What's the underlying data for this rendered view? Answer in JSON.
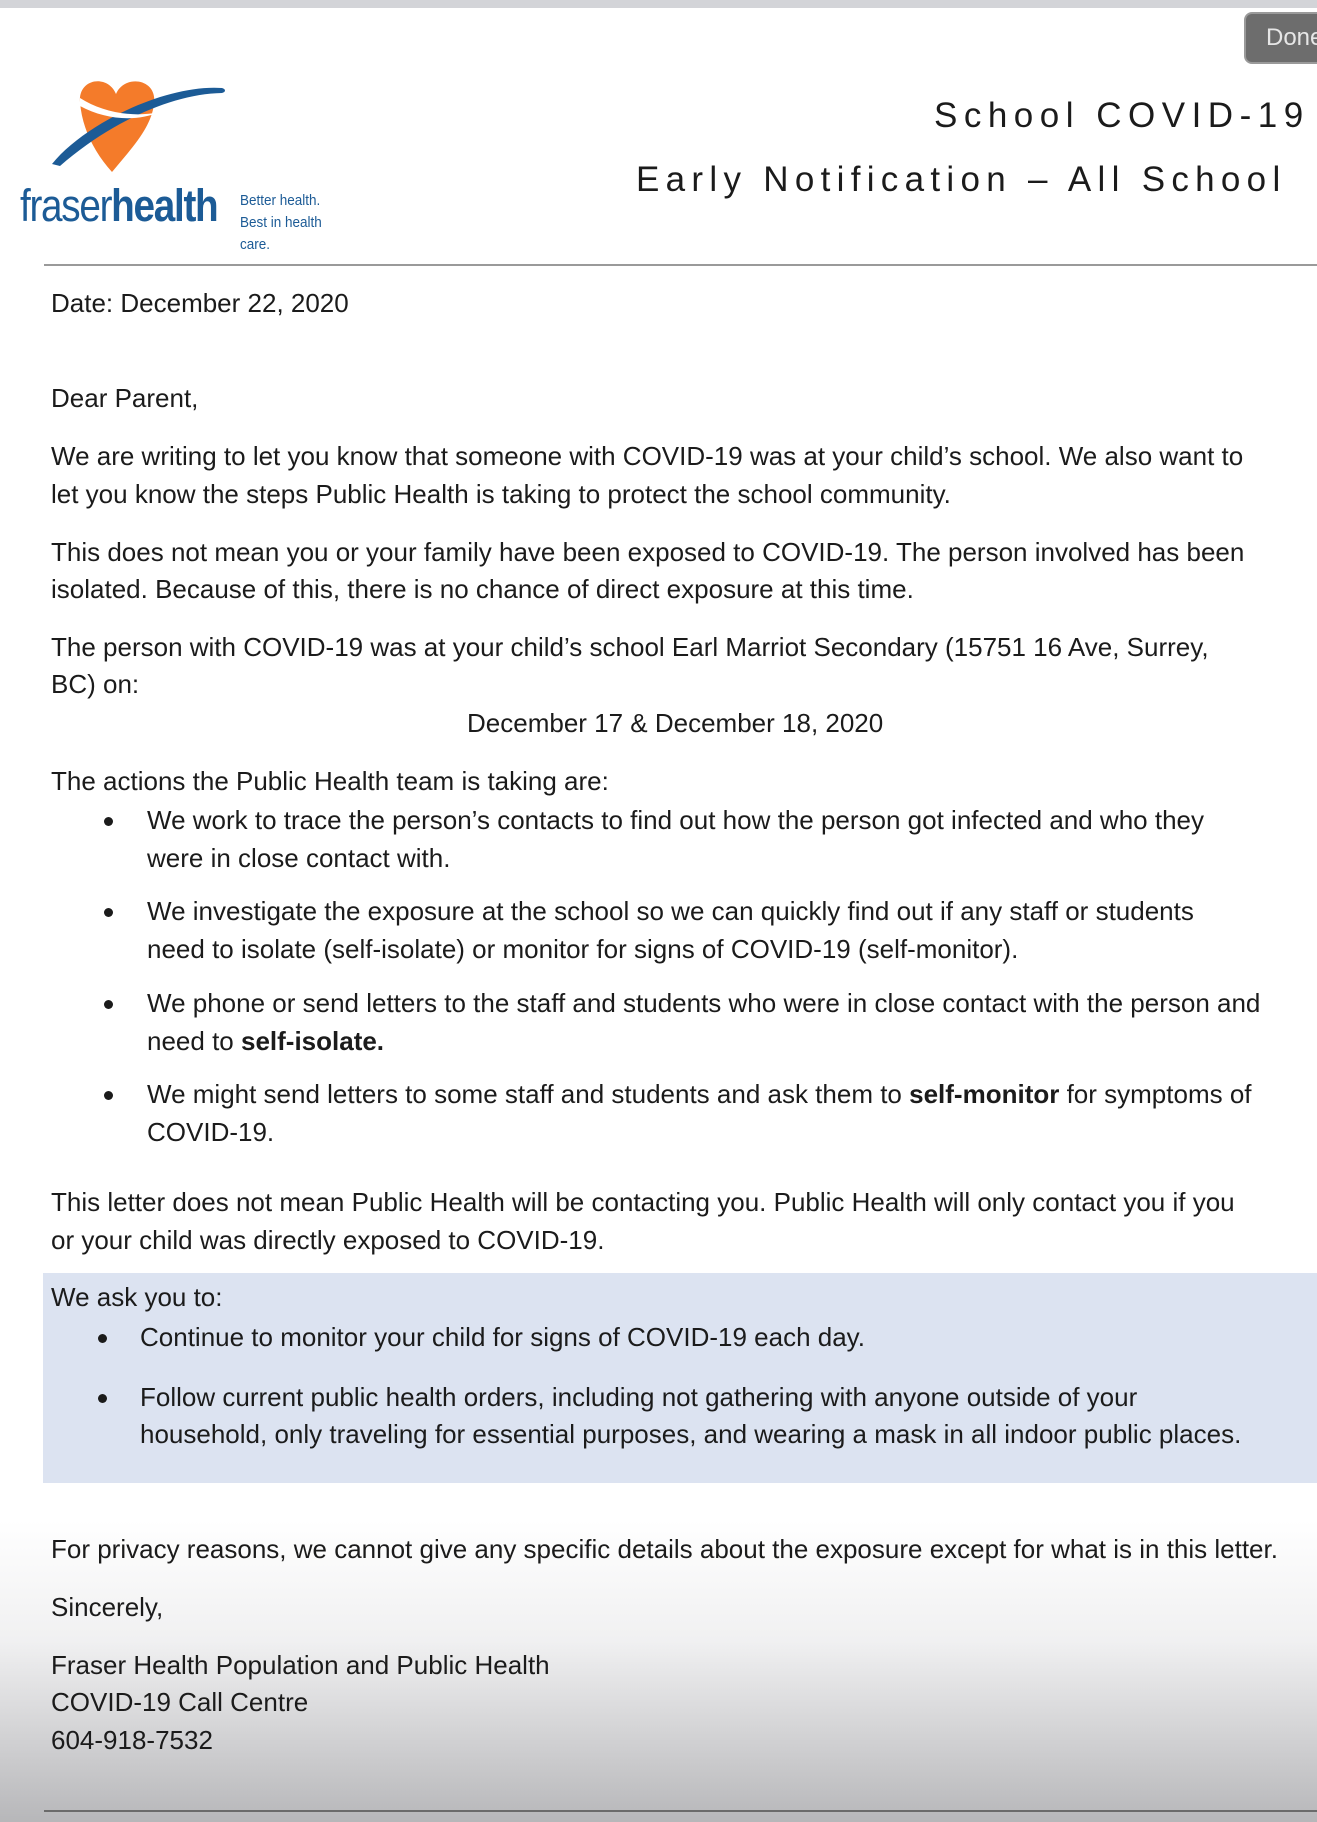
{
  "toolbar": {
    "done_label": "Done"
  },
  "logo": {
    "name_part1": "fraser",
    "name_part2": "health",
    "tagline_line1": "Better health.",
    "tagline_line2": "Best in health care.",
    "colors": {
      "orange": "#f47b2a",
      "blue": "#1c5b96"
    }
  },
  "header": {
    "title_line1": "School COVID-19",
    "title_line2": "Early Notification – All School"
  },
  "letter": {
    "date": "Date: December 22, 2020",
    "greeting": "Dear Parent,",
    "para1_line1": "We are writing to let you know that someone with COVID-19 was at your child’s school. We also want to",
    "para1_line2": "let you know the steps Public Health is taking to protect the school community.",
    "para2_line1": "This does not mean you or your family have been exposed to COVID-19. The person involved has been",
    "para2_line2": "isolated. Because of this, there is no chance of direct exposure at this time.",
    "para3_line1": "The person with COVID-19 was at your child’s school Earl Marriot Secondary (15751 16 Ave, Surrey,",
    "para3_line2": "BC) on:",
    "exposure_dates": "December 17 & December 18, 2020",
    "actions_intro": "The actions the Public Health team is taking are:",
    "actions": [
      {
        "line1": "We work to trace the person’s contacts to find out how the person got infected and who they",
        "line2": "were in close contact with."
      },
      {
        "line1": "We investigate the exposure at the school so we can quickly find out if any staff or students",
        "line2": "need to isolate (self-isolate) or monitor for signs of COVID-19 (self-monitor)."
      },
      {
        "line1": "We phone or send letters to the staff and students who were in close contact with the person and",
        "line2_pre": "need to ",
        "line2_bold": "self-isolate."
      },
      {
        "line1_pre": "We might send letters to some staff and students and ask them to ",
        "line1_bold": "self-monitor",
        "line1_post": " for symptoms of",
        "line2": "COVID-19."
      }
    ],
    "para4_line1": "This letter does not mean Public Health will be contacting you. Public Health will only contact you if you",
    "para4_line2": "or your child was directly exposed to COVID-19.",
    "ask": {
      "intro": "We ask you to:",
      "items": [
        {
          "line1": "Continue to monitor your child for signs of COVID-19 each day."
        },
        {
          "line1": "Follow current public health orders, including not gathering with anyone outside of your",
          "line2": "household, only traveling for essential purposes, and wearing a mask in all indoor public places."
        }
      ],
      "box_color": "#dce3f1"
    },
    "privacy": "For privacy reasons, we cannot give any specific details about the exposure except for what is in this letter.",
    "closing": "Sincerely,",
    "signature_line1": "Fraser Health Population and Public Health",
    "signature_line2": "COVID-19 Call Centre",
    "signature_phone": "604-918-7532"
  }
}
